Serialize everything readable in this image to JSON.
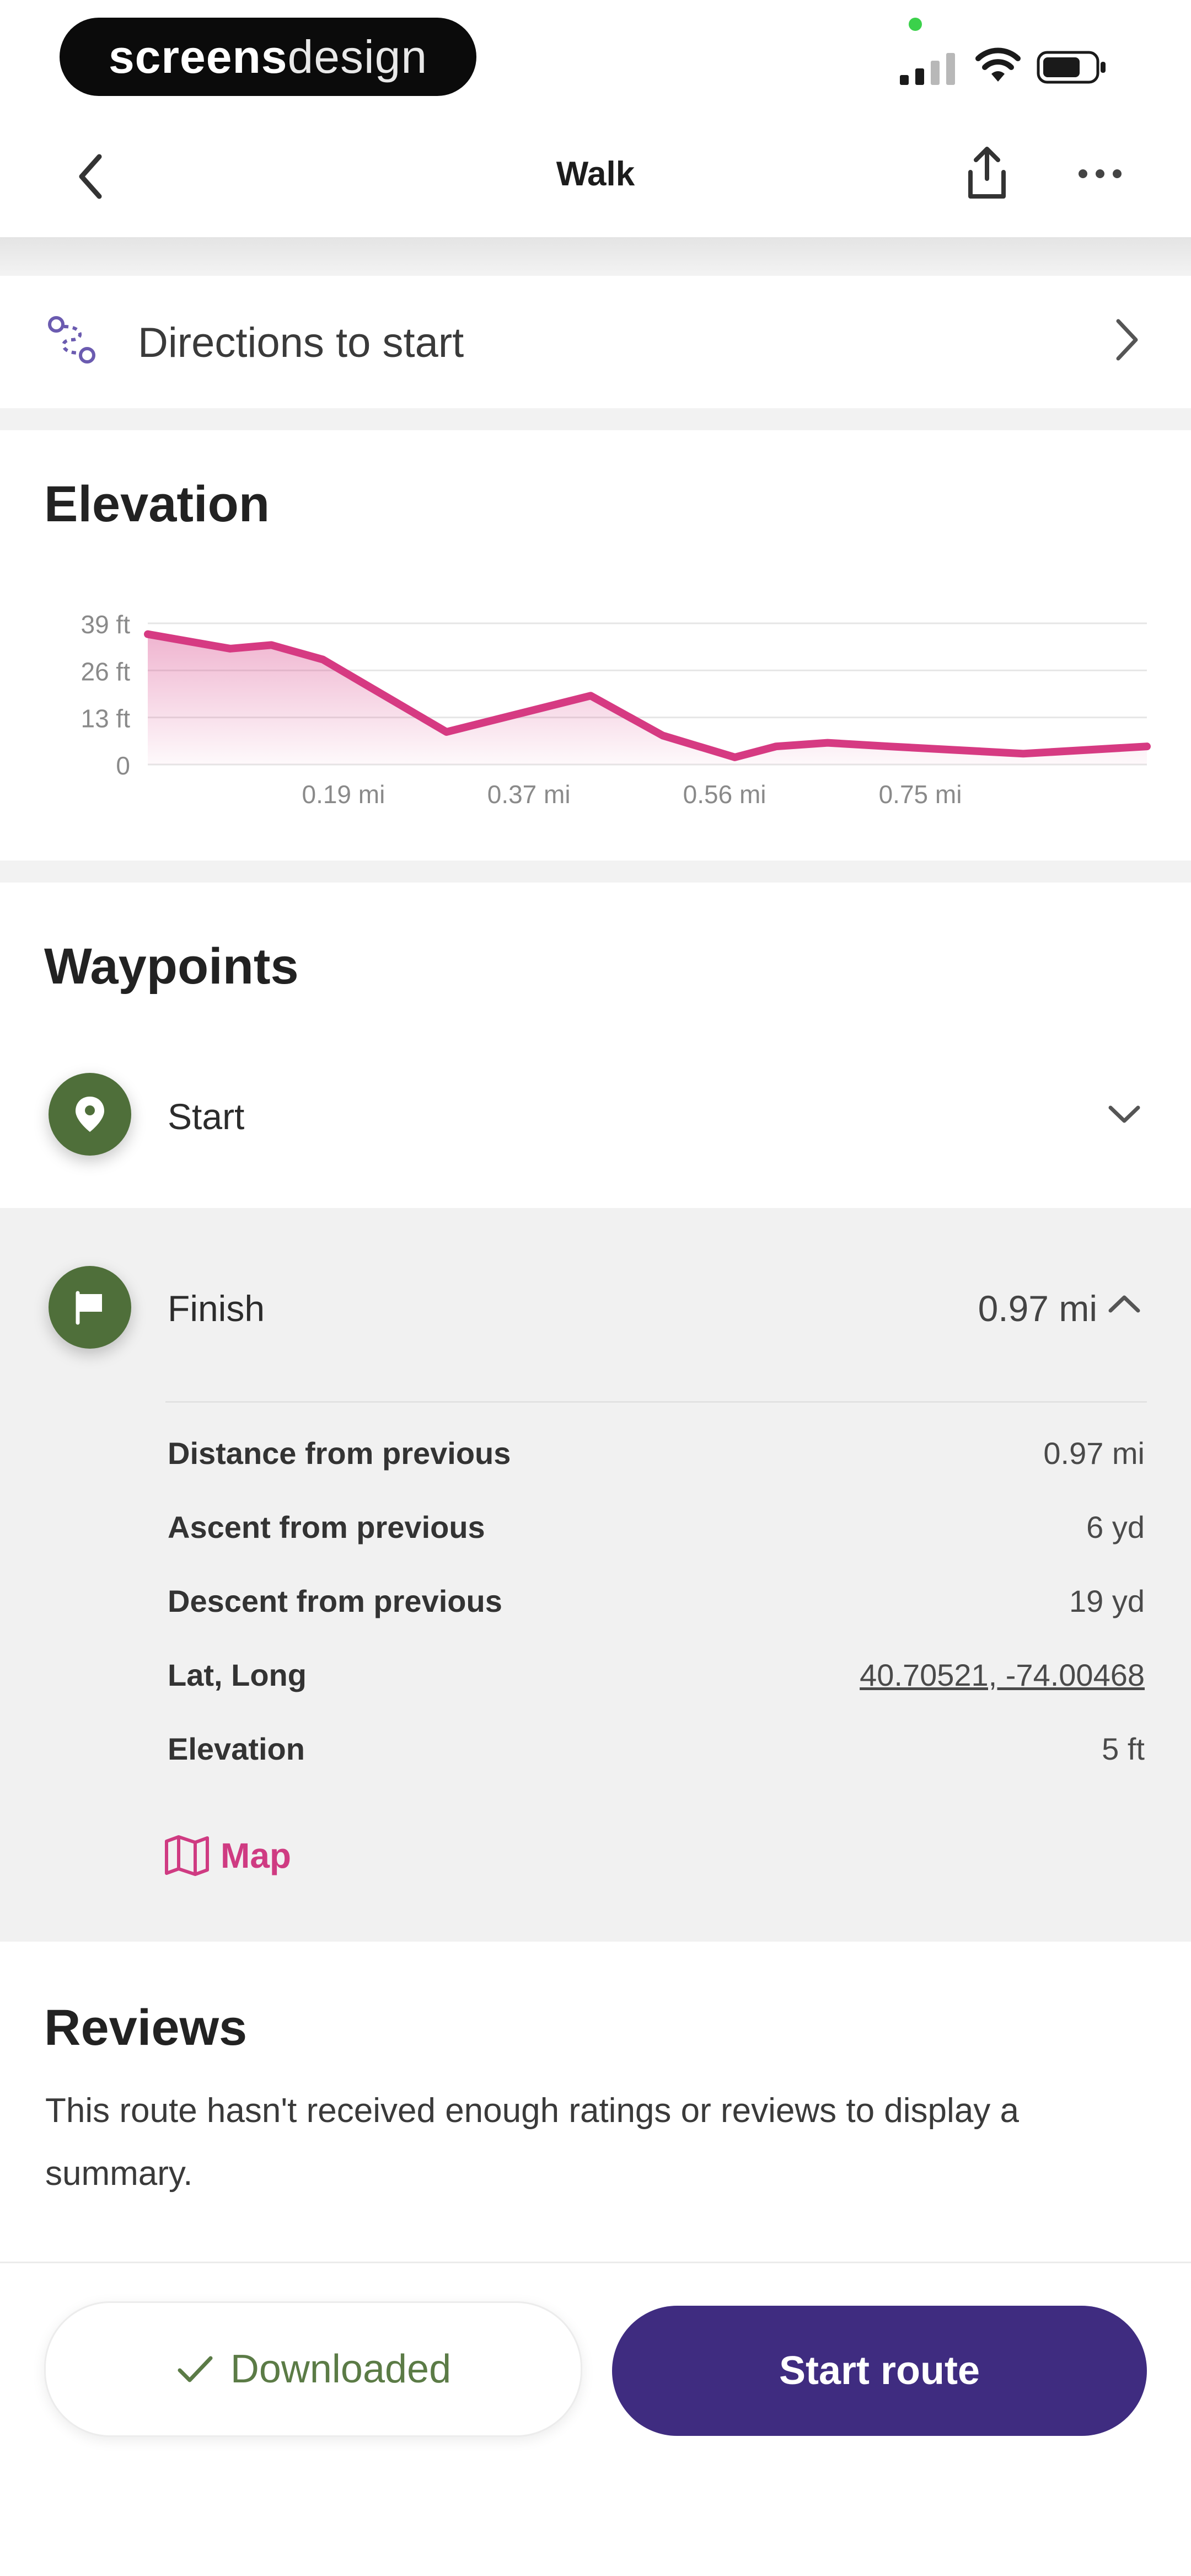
{
  "status_bar": {
    "brand_bold": "screens",
    "brand_light": "design"
  },
  "header": {
    "title": "Walk"
  },
  "directions": {
    "label": "Directions to start"
  },
  "elevation": {
    "title": "Elevation"
  },
  "chart_data": {
    "type": "area",
    "title": "Elevation",
    "y_ticks": [
      "39 ft",
      "26 ft",
      "13 ft",
      "0"
    ],
    "x_ticks": [
      "0.19 mi",
      "0.37 mi",
      "0.56 mi",
      "0.75 mi"
    ],
    "ylim": [
      0,
      39
    ],
    "xlim": [
      0,
      0.97
    ],
    "x": [
      0,
      0.08,
      0.12,
      0.17,
      0.29,
      0.43,
      0.5,
      0.57,
      0.61,
      0.66,
      0.72,
      0.85,
      0.97
    ],
    "y": [
      36,
      32,
      33,
      29,
      9,
      19,
      8,
      2,
      5,
      6,
      5,
      3,
      5
    ],
    "series_color": "#d63a82",
    "grid": true
  },
  "waypoints": {
    "title": "Waypoints",
    "start": {
      "label": "Start"
    },
    "finish": {
      "label": "Finish",
      "distance": "0.97 mi",
      "details": [
        {
          "label": "Distance from previous",
          "value": "0.97 mi"
        },
        {
          "label": "Ascent from previous",
          "value": "6 yd"
        },
        {
          "label": "Descent from previous",
          "value": "19 yd"
        },
        {
          "label": "Lat, Long",
          "value": "40.70521, -74.00468"
        },
        {
          "label": "Elevation",
          "value": "5 ft"
        }
      ],
      "map_link": "Map"
    }
  },
  "reviews": {
    "title": "Reviews",
    "text": "This route hasn't received enough ratings or reviews to display a summary."
  },
  "actions": {
    "downloaded_label": "Downloaded",
    "start_label": "Start route"
  },
  "colors": {
    "accent": "#d63a82",
    "primary": "#3f2c80",
    "waypoint_pin": "#4f6f3a"
  }
}
